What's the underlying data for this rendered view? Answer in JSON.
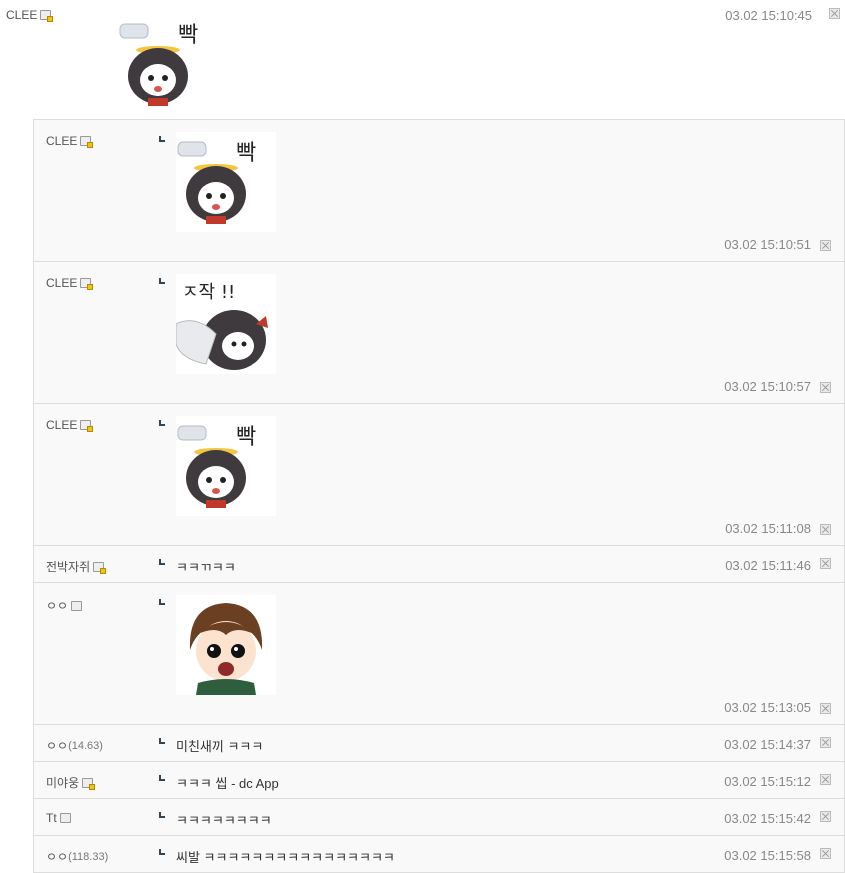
{
  "top_comment": {
    "nick": "CLEE",
    "time": "03.02 15:10:45",
    "sticker": {
      "caption": "빡",
      "kind": "ppak"
    }
  },
  "replies": [
    {
      "nick": "CLEE",
      "badge": "gold",
      "sticker": {
        "caption": "빡",
        "kind": "ppak"
      },
      "time": "03.02 15:10:51"
    },
    {
      "nick": "CLEE",
      "badge": "gold",
      "sticker": {
        "caption": "ㅈ작 !!",
        "kind": "slap"
      },
      "time": "03.02 15:10:57"
    },
    {
      "nick": "CLEE",
      "badge": "gold",
      "sticker": {
        "caption": "빡",
        "kind": "ppak"
      },
      "time": "03.02 15:11:08"
    },
    {
      "nick": "전박자쥐",
      "badge": "gold",
      "text": "ㅋㅋㄲㅋㅋ",
      "time": "03.02 15:11:46"
    },
    {
      "nick": "ㅇㅇ",
      "badge": "plain",
      "sticker": {
        "caption": "",
        "kind": "crying-boy"
      },
      "time": "03.02 15:13:05"
    },
    {
      "nick": "ㅇㅇ",
      "ip": "(14.63)",
      "text": "미친새끼 ㅋㅋㅋ",
      "time": "03.02 15:14:37"
    },
    {
      "nick": "미야웅",
      "badge": "gold",
      "text": "ㅋㅋㅋ 씹 - dc App",
      "time": "03.02 15:15:12"
    },
    {
      "nick": "Tt",
      "badge": "plain",
      "text": "ㅋㅋㅋㅋㅋㅋㅋㅋ",
      "time": "03.02 15:15:42"
    },
    {
      "nick": "ㅇㅇ",
      "ip": "(118.33)",
      "text": "씨발 ㅋㅋㅋㅋㅋㅋㅋㅋㅋㅋㅋㅋㅋㅋㅋㅋ",
      "time": "03.02 15:15:58"
    }
  ],
  "colors": {
    "time": "#888888",
    "border": "#dddddd",
    "reply_bg": "#f9f9f9",
    "reply_mark": "#334455"
  }
}
